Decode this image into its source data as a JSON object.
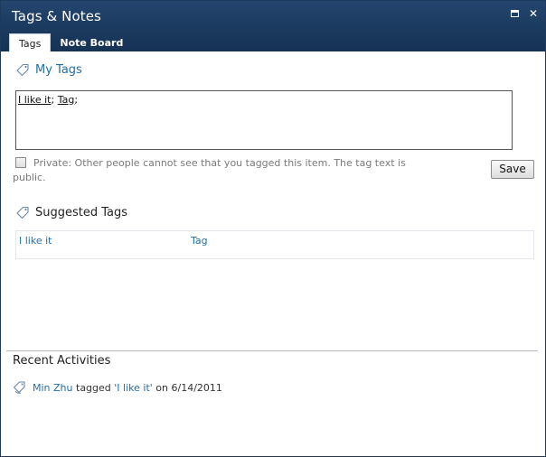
{
  "dialog": {
    "title": "Tags & Notes",
    "maximize_symbol": "",
    "close_symbol": "✕"
  },
  "tabs": [
    {
      "label": "Tags",
      "active": true
    },
    {
      "label": "Note Board",
      "active": false
    }
  ],
  "my_tags": {
    "heading": "My Tags",
    "tags": [
      "I like it",
      "Tag"
    ],
    "separator": ";"
  },
  "private": {
    "checked": false,
    "text_line1": "Private: Other people cannot see that you tagged this item. The tag text is",
    "text_line2": "public."
  },
  "save_button": {
    "label": "Save"
  },
  "suggested_tags": {
    "heading": "Suggested Tags",
    "items": [
      "I like it",
      "Tag"
    ]
  },
  "recent_activities": {
    "heading": "Recent Activities",
    "activity": {
      "user": "Min Zhu",
      "action": "tagged",
      "tag": "'I like it'",
      "preposition": "on",
      "date": "6/14/2011"
    }
  },
  "colors": {
    "title_bar": "#1b3a5f",
    "link": "#1f6fae",
    "icon": "tag-icon"
  }
}
